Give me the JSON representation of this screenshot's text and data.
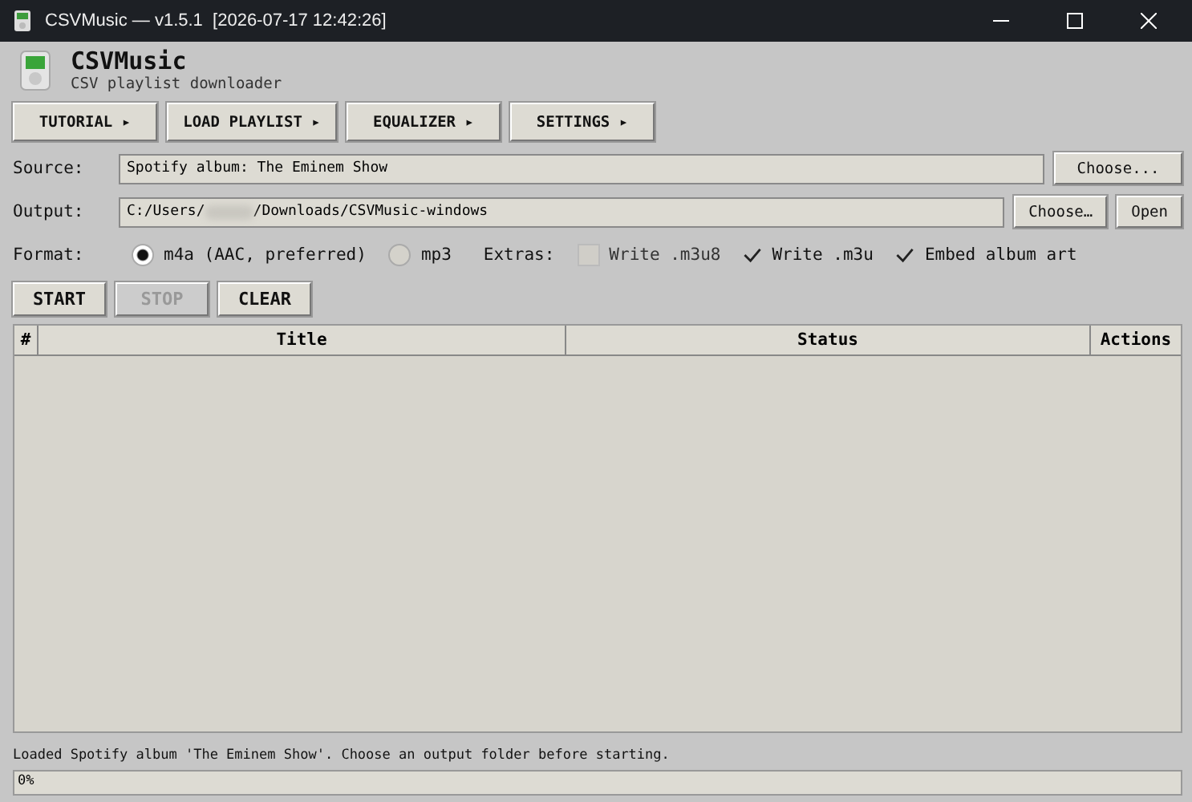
{
  "window": {
    "title": "CSVMusic — v1.5.1  [2026-07-17 12:42:26]"
  },
  "header": {
    "title": "CSVMusic",
    "subtitle": "CSV playlist downloader"
  },
  "menu": [
    {
      "label": "TUTORIAL ▸"
    },
    {
      "label": "LOAD PLAYLIST ▸"
    },
    {
      "label": "EQUALIZER ▸"
    },
    {
      "label": "SETTINGS ▸"
    }
  ],
  "source": {
    "label": "Source:",
    "value": "Spotify album: The Eminem Show",
    "button": "Choose..."
  },
  "output": {
    "label": "Output:",
    "value_start": "C:/Users/",
    "value_end": "/Downloads/CSVMusic-windows",
    "buttons": [
      "Choose…",
      "Open"
    ]
  },
  "format": {
    "label": "Format:",
    "options": [
      {
        "label": "m4a (AAC, preferred)",
        "selected": true
      },
      {
        "label": "mp3",
        "selected": false
      }
    ]
  },
  "extras": {
    "label": "Extras:",
    "options": [
      {
        "label": "Write .m3u8",
        "checked": false,
        "disabled": true
      },
      {
        "label": "Write .m3u",
        "checked": true,
        "disabled": false
      },
      {
        "label": "Embed album art",
        "checked": true,
        "disabled": false
      }
    ]
  },
  "actions": [
    {
      "label": "START",
      "disabled": false
    },
    {
      "label": "STOP",
      "disabled": true
    },
    {
      "label": "CLEAR",
      "disabled": false
    }
  ],
  "table": {
    "columns": [
      "#",
      "Title",
      "Status",
      "Actions"
    ]
  },
  "status_bar": "Loaded Spotify album 'The Eminem Show'. Choose an output folder before starting.",
  "progress": {
    "label": "0%",
    "level": 0
  }
}
